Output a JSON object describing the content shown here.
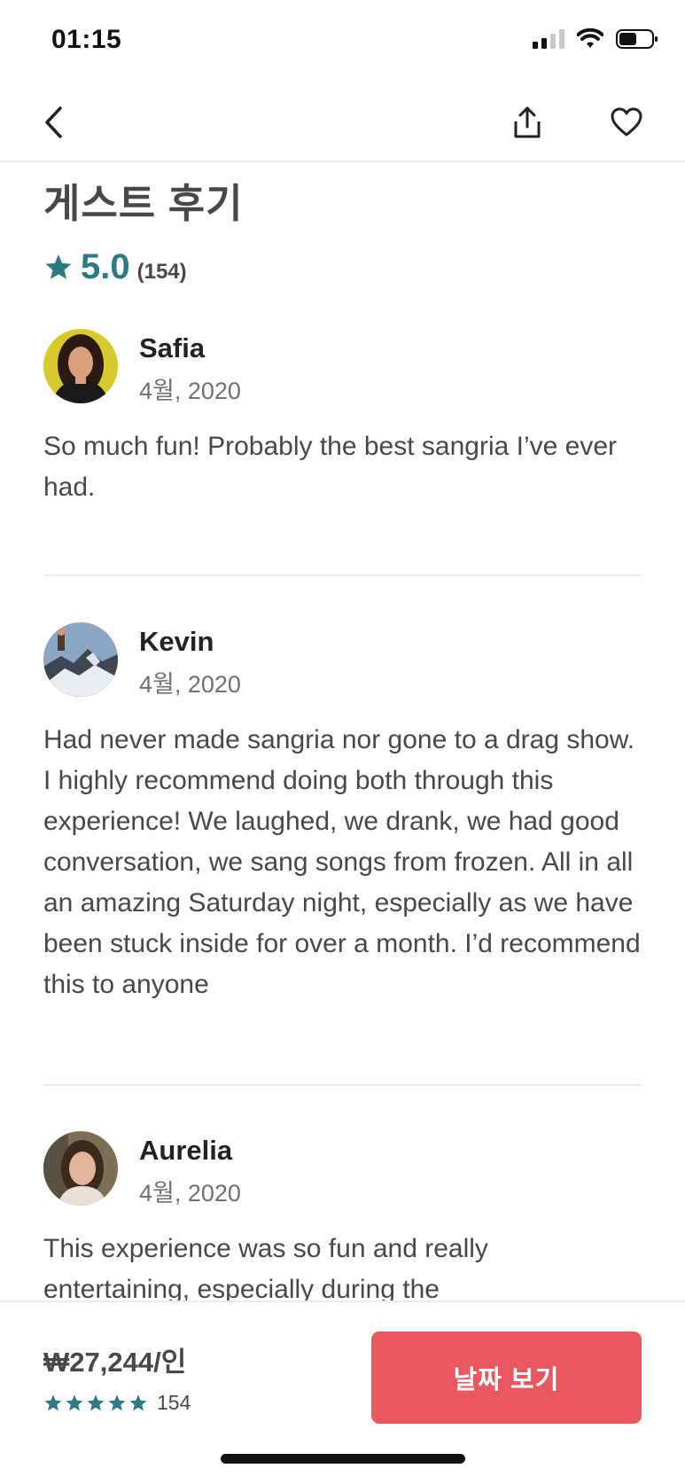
{
  "status_bar": {
    "time": "01:15"
  },
  "colors": {
    "accent_teal": "#2b7a84",
    "cta_red": "#e8585e",
    "text_dark": "#484848",
    "text_muted": "#717171"
  },
  "nav": {
    "icons": [
      "back-chevron-icon",
      "share-icon",
      "heart-icon"
    ]
  },
  "header": {
    "title": "게스트 후기",
    "rating": "5.0",
    "review_count": "(154)"
  },
  "reviews": [
    {
      "name": "Safia",
      "date": "4월, 2020",
      "text": "So much fun! Probably the best sangria I’ve ever had."
    },
    {
      "name": "Kevin",
      "date": "4월, 2020",
      "text": "Had never made sangria nor gone to a drag show. I highly recommend doing both through this experience! We laughed, we drank, we had good conversation, we sang songs from frozen. All in all an amazing Saturday night, especially as we have been stuck inside for over a month. I’d recommend this to anyone"
    },
    {
      "name": "Aurelia",
      "date": "4월, 2020",
      "text": "This experience was so fun and really entertaining, especially during the"
    }
  ],
  "footer": {
    "price": "₩27,244/인",
    "star_count": 5,
    "rating_count": "154",
    "cta_label": "날짜 보기"
  }
}
